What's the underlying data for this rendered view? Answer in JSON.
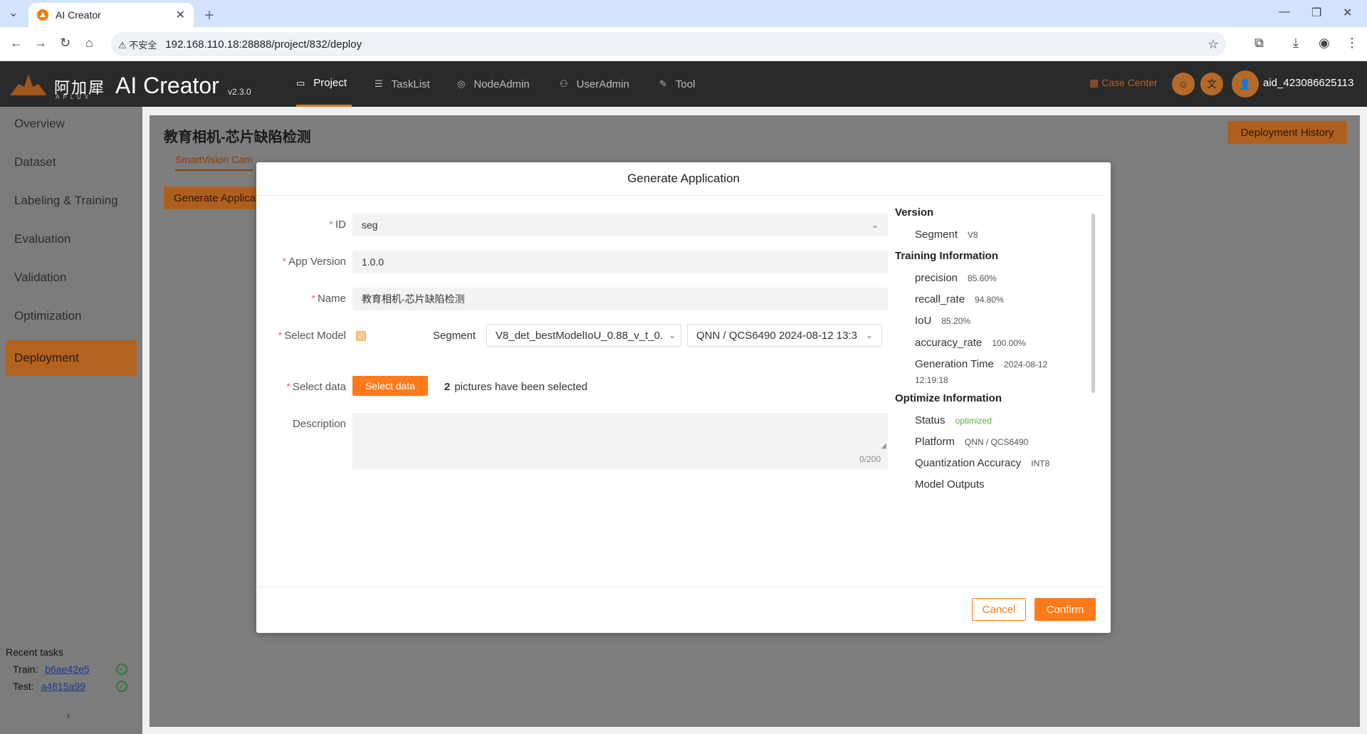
{
  "browser": {
    "tab_title": "AI Creator",
    "security_label": "不安全",
    "url": "192.168.110.18:28888/project/832/deploy"
  },
  "app": {
    "brand_cn": "阿加犀",
    "brand_sub": "APLUX",
    "brand_name": "AI Creator",
    "version": "v2.3.0",
    "menu": [
      {
        "label": "Project",
        "icon": "folder-icon",
        "active": true
      },
      {
        "label": "TaskList",
        "icon": "list-icon",
        "active": false
      },
      {
        "label": "NodeAdmin",
        "icon": "node-icon",
        "active": false
      },
      {
        "label": "UserAdmin",
        "icon": "user-icon",
        "active": false
      },
      {
        "label": "Tool",
        "icon": "wrench-icon",
        "active": false
      }
    ],
    "case_center": "Case Center",
    "username": "aid_423086625113"
  },
  "sidebar": {
    "items": [
      {
        "label": "Overview"
      },
      {
        "label": "Dataset"
      },
      {
        "label": "Labeling & Training"
      },
      {
        "label": "Evaluation"
      },
      {
        "label": "Validation"
      },
      {
        "label": "Optimization"
      },
      {
        "label": "Deployment",
        "active": true
      }
    ],
    "recent_title": "Recent tasks",
    "train_label": "Train:",
    "train_id": "b6ae42e5",
    "test_label": "Test:",
    "test_id": "a4815a99",
    "collapse_icon": "chevron-left-icon"
  },
  "page": {
    "title": "教育相机-芯片缺陷检测",
    "deploy_history": "Deployment History",
    "subtab": "SmartVision Cam",
    "generate_button": "Generate Applica"
  },
  "modal": {
    "title": "Generate Application",
    "fields": {
      "id_label": "ID",
      "id_value": "seg",
      "app_version_label": "App Version",
      "app_version_value": "1.0.0",
      "name_label": "Name",
      "name_value": "教育相机-芯片缺陷检测",
      "select_model_label": "Select Model",
      "segment_label": "Segment",
      "model_value": "V8_det_bestModelIoU_0.88_v_t_0.",
      "platform_value": "QNN / QCS6490 2024-08-12 13:3",
      "select_data_label": "Select data",
      "select_data_button": "Select data",
      "pictures_count": "2",
      "pictures_text": "pictures have been selected",
      "description_label": "Description",
      "description_value": "",
      "description_count": "0/200"
    },
    "info": {
      "version_title": "Version",
      "version_key": "Segment",
      "version_val": "V8",
      "training_title": "Training Information",
      "training": [
        {
          "key": "precision",
          "val": "85.60%"
        },
        {
          "key": "recall_rate",
          "val": "94.80%"
        },
        {
          "key": "IoU",
          "val": "85.20%"
        },
        {
          "key": "accuracy_rate",
          "val": "100.00%"
        }
      ],
      "gen_time_key": "Generation Time",
      "gen_time_date": "2024-08-12",
      "gen_time_time": "12:19:18",
      "optimize_title": "Optimize Information",
      "status_key": "Status",
      "status_val": "optimized",
      "platform_key": "Platform",
      "platform_val": "QNN / QCS6490",
      "quant_key": "Quantization Accuracy",
      "quant_val": "INT8",
      "outputs_key": "Model Outputs"
    },
    "cancel": "Cancel",
    "confirm": "Confirm"
  },
  "colors": {
    "accent": "#ff7a1a",
    "success": "#52b03a",
    "required": "#f56c6c"
  }
}
